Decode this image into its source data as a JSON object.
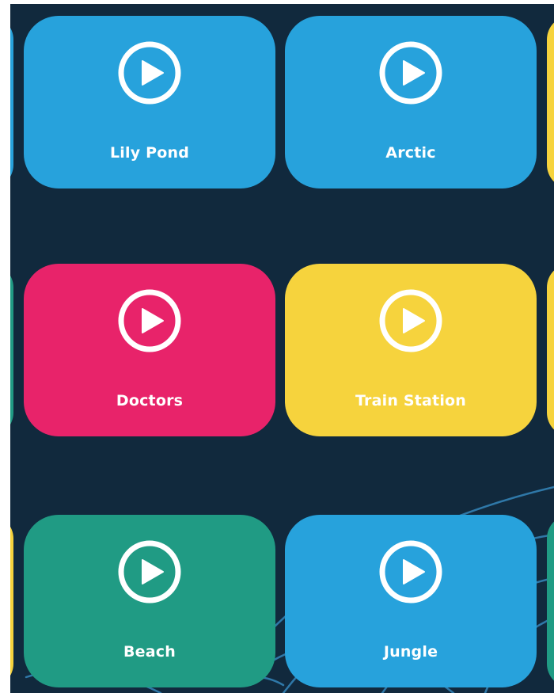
{
  "colors": {
    "background": "#11293d",
    "blue": "#27a2dc",
    "pink": "#e8236a",
    "yellow": "#f6d33d",
    "green": "#209b84",
    "label": "#ffffff"
  },
  "tiles": [
    {
      "label": "Lily Pond",
      "color": "blue",
      "icon": "play-circle-icon"
    },
    {
      "label": "Arctic",
      "color": "blue",
      "icon": "play-circle-icon"
    },
    {
      "label": "Doctors",
      "color": "pink",
      "icon": "play-circle-icon"
    },
    {
      "label": "Train Station",
      "color": "yellow",
      "icon": "play-circle-icon"
    },
    {
      "label": "Beach",
      "color": "green",
      "icon": "play-circle-icon"
    },
    {
      "label": "Jungle",
      "color": "blue",
      "icon": "play-circle-icon"
    }
  ],
  "partial_tiles": {
    "left": [
      "blue",
      "green",
      "yellow"
    ],
    "right": [
      "yellow",
      "yellow",
      "green"
    ]
  }
}
